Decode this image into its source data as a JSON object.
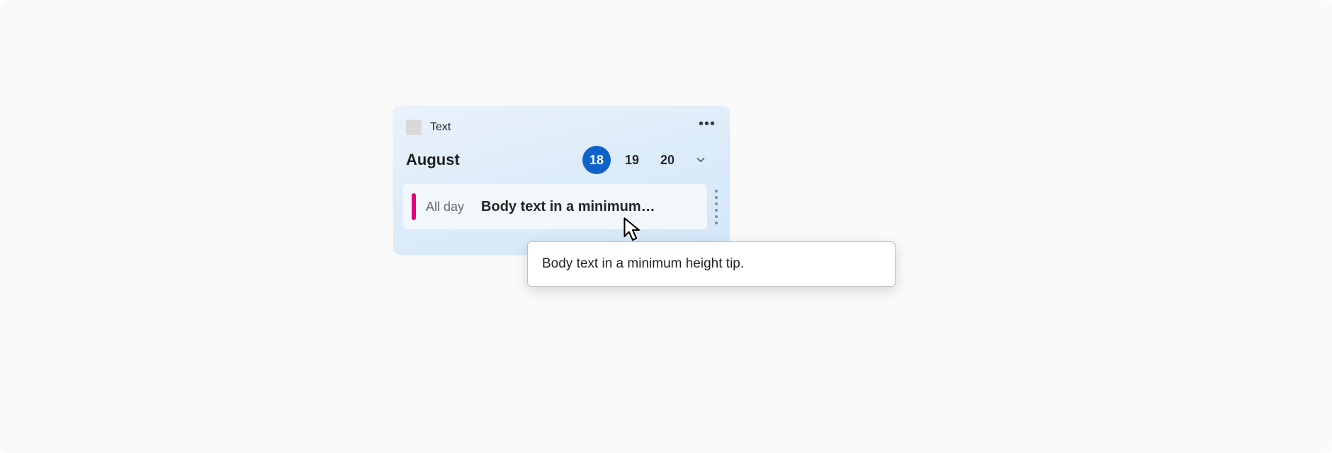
{
  "header": {
    "title": "Text"
  },
  "month": {
    "label": "August"
  },
  "dates": [
    {
      "value": "18",
      "selected": true
    },
    {
      "value": "19",
      "selected": false
    },
    {
      "value": "20",
      "selected": false
    }
  ],
  "event": {
    "time_label": "All day",
    "title": "Body text in a minimum…",
    "accent": "#e5007e"
  },
  "tooltip": {
    "text": "Body text in a minimum height tip."
  }
}
